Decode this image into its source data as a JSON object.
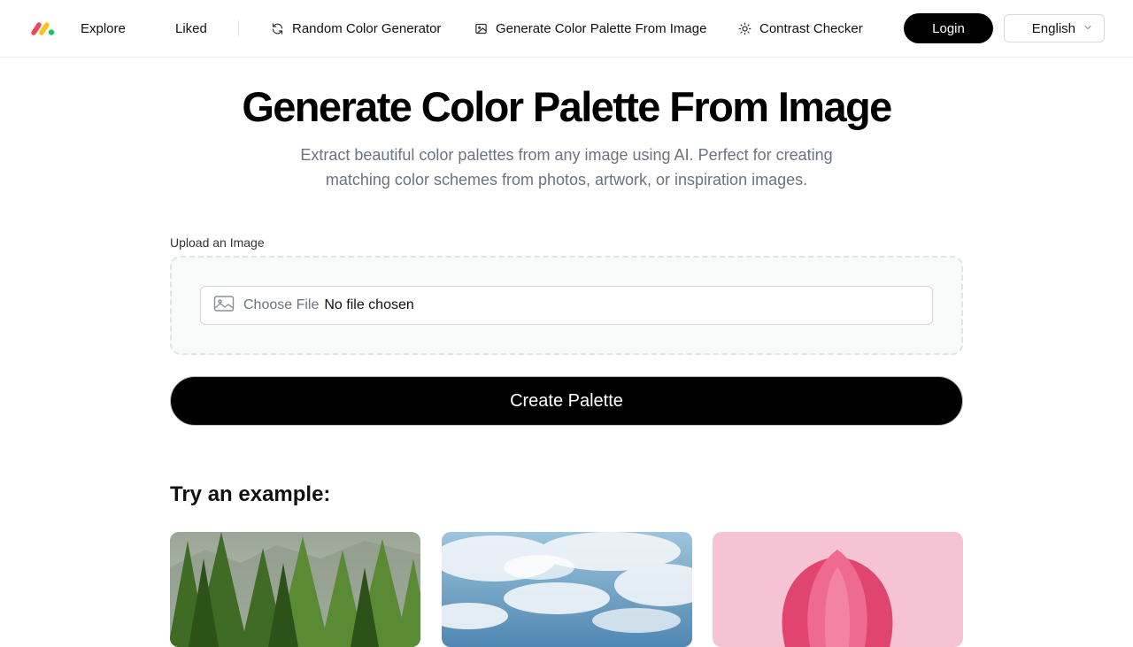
{
  "nav": {
    "explore": "Explore",
    "liked": "Liked",
    "random_color_generator": "Random Color Generator",
    "generate_from_image": "Generate Color Palette From Image",
    "contrast_checker": "Contrast Checker",
    "login": "Login",
    "language": "English"
  },
  "hero": {
    "title": "Generate Color Palette From Image",
    "subtitle_line1": "Extract beautiful color palettes from any image using AI. Perfect for creating",
    "subtitle_line2": "matching color schemes from photos, artwork, or inspiration images."
  },
  "upload": {
    "label": "Upload an Image",
    "choose_file": "Choose File",
    "no_file": "No file chosen",
    "create_button": "Create Palette"
  },
  "examples": {
    "title": "Try an example:",
    "items": [
      {
        "icon": "forest-image"
      },
      {
        "icon": "sky-image"
      },
      {
        "icon": "tulip-image"
      }
    ]
  },
  "colors": {
    "logo_red": "#f0455c",
    "logo_yellow": "#ffc21a",
    "logo_green": "#21c46e",
    "primary": "#000000",
    "muted_text": "#6b7280"
  }
}
